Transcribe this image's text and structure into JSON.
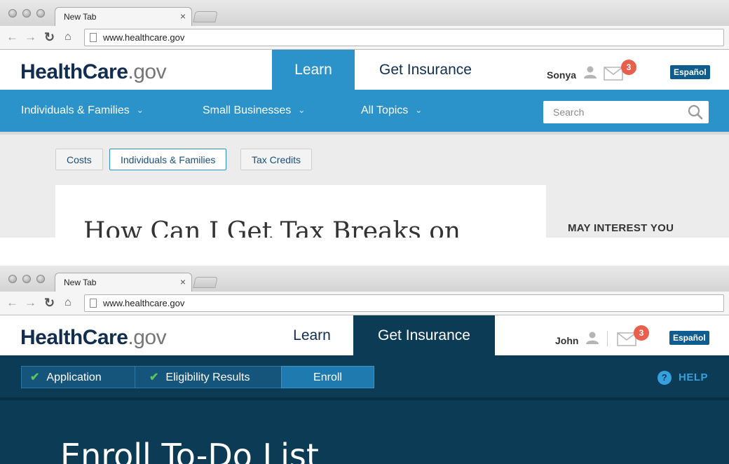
{
  "windows": [
    {
      "tab": {
        "title": "New Tab",
        "close": "×"
      },
      "url": "www.healthcare.gov",
      "logo": {
        "brand": "HealthCare",
        "tld": ".gov"
      },
      "nav": {
        "learn": "Learn",
        "get_insurance": "Get Insurance"
      },
      "user": {
        "name": "Sonya",
        "messages": "3"
      },
      "espanol": "Español",
      "subnav": [
        "Individuals & Families",
        "Small Businesses",
        "All Topics"
      ],
      "search_placeholder": "Search",
      "chips": [
        "Costs",
        "Individuals & Families",
        "Tax Credits"
      ],
      "article_title": "How Can I Get Tax Breaks on",
      "sidebar_heading": "MAY INTEREST YOU"
    },
    {
      "tab": {
        "title": "New Tab",
        "close": "×"
      },
      "url": "www.healthcare.gov",
      "logo": {
        "brand": "HealthCare",
        "tld": ".gov"
      },
      "nav": {
        "learn": "Learn",
        "get_insurance": "Get Insurance"
      },
      "user": {
        "name": "John",
        "messages": "3"
      },
      "espanol": "Español",
      "steps": [
        "Application",
        "Eligibility Results",
        "Enroll"
      ],
      "help": "HELP",
      "page_title": "Enroll To-Do List"
    }
  ],
  "colors": {
    "brand_blue": "#2b93c9",
    "navy": "#0c3b55",
    "badge": "#e8604c"
  }
}
